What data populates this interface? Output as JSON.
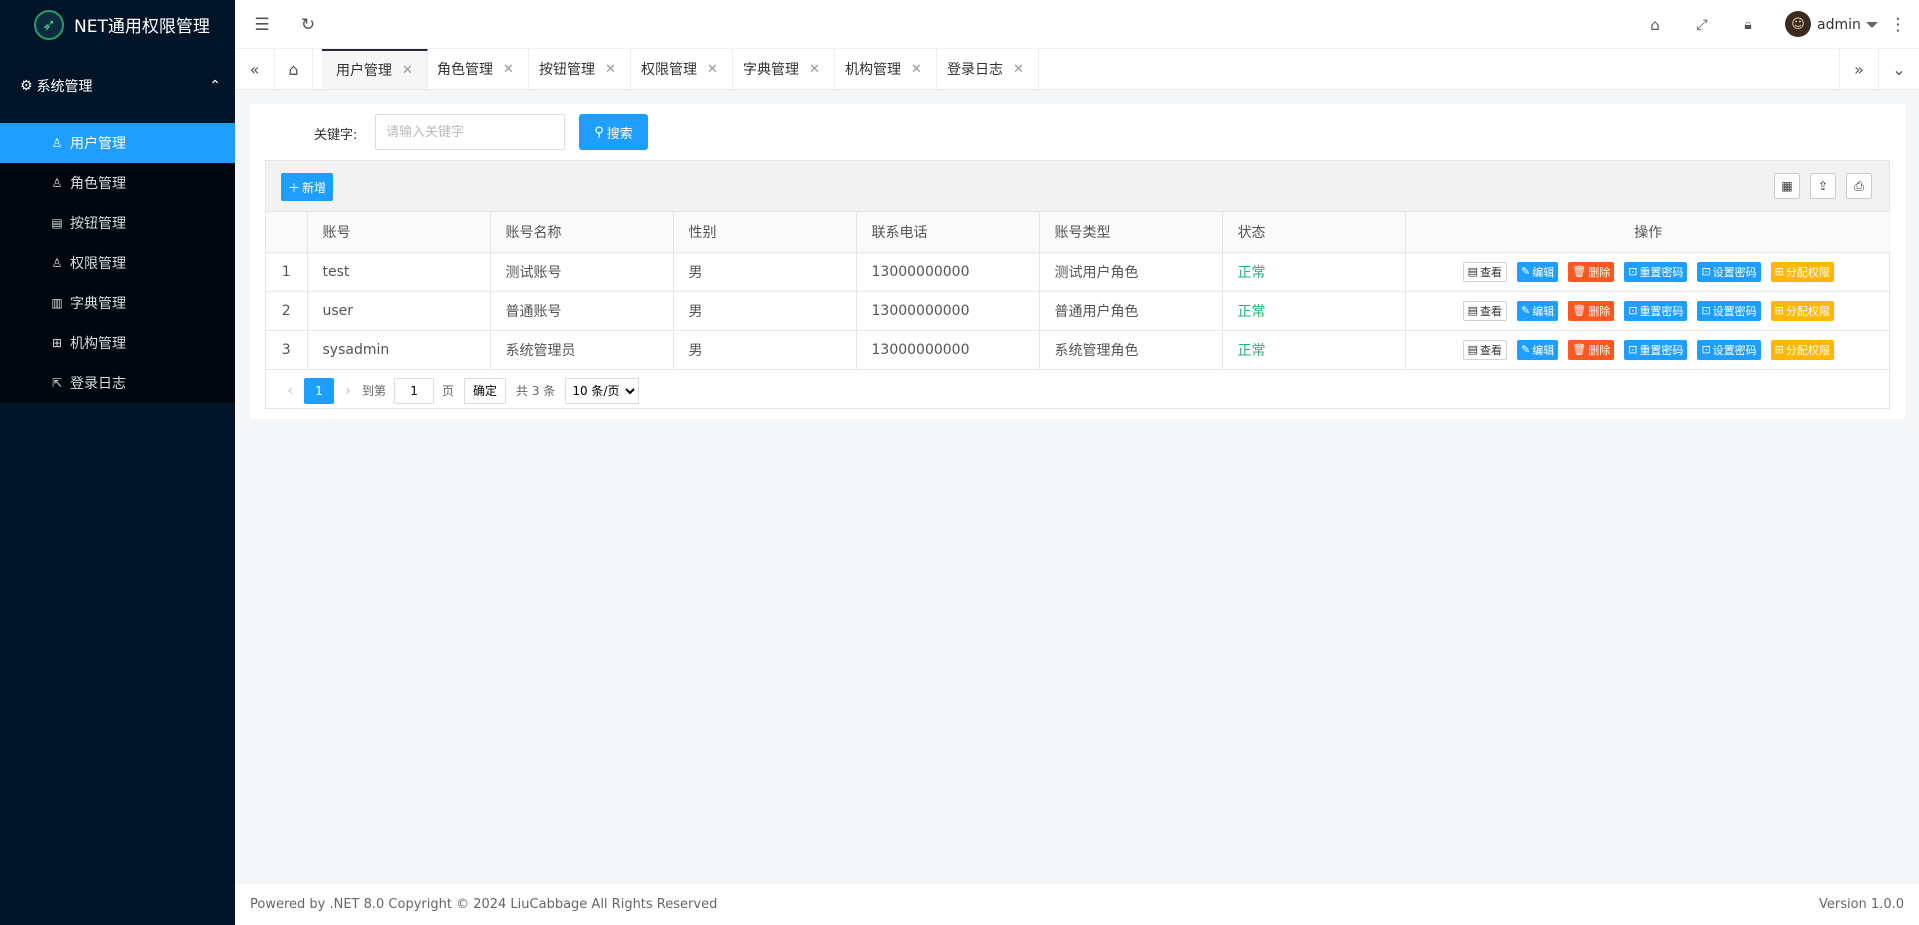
{
  "app": {
    "title": "NET通用权限管理"
  },
  "sidebar": {
    "group_label": "系统管理",
    "items": [
      {
        "label": "用户管理",
        "icon": "user-icon"
      },
      {
        "label": "角色管理",
        "icon": "role-icon"
      },
      {
        "label": "按钮管理",
        "icon": "button-icon"
      },
      {
        "label": "权限管理",
        "icon": "permission-icon"
      },
      {
        "label": "字典管理",
        "icon": "dictionary-icon"
      },
      {
        "label": "机构管理",
        "icon": "organization-icon"
      },
      {
        "label": "登录日志",
        "icon": "login-log-icon"
      }
    ]
  },
  "header": {
    "username": "admin"
  },
  "tabs": [
    {
      "label": "用户管理",
      "active": true
    },
    {
      "label": "角色管理"
    },
    {
      "label": "按钮管理"
    },
    {
      "label": "权限管理"
    },
    {
      "label": "字典管理"
    },
    {
      "label": "机构管理"
    },
    {
      "label": "登录日志"
    }
  ],
  "search": {
    "label": "关键字:",
    "placeholder": "请输入关键字",
    "button": "搜索"
  },
  "toolbar": {
    "add_label": "新增"
  },
  "table": {
    "headers": [
      "",
      "账号",
      "账号名称",
      "性别",
      "联系电话",
      "账号类型",
      "状态",
      "操作"
    ],
    "rows": [
      {
        "index": "1",
        "account": "test",
        "name": "测试账号",
        "gender": "男",
        "phone": "13000000000",
        "type": "测试用户角色",
        "status": "正常"
      },
      {
        "index": "2",
        "account": "user",
        "name": "普通账号",
        "gender": "男",
        "phone": "13000000000",
        "type": "普通用户角色",
        "status": "正常"
      },
      {
        "index": "3",
        "account": "sysadmin",
        "name": "系统管理员",
        "gender": "男",
        "phone": "13000000000",
        "type": "系统管理角色",
        "status": "正常"
      }
    ],
    "actions": {
      "view": "查看",
      "edit": "编辑",
      "delete": "删除",
      "reset": "重置密码",
      "set": "设置密码",
      "perm": "分配权限"
    }
  },
  "pager": {
    "current": "1",
    "goto": "到第",
    "page_input": "1",
    "page_unit": "页",
    "ok": "确定",
    "total": "共 3 条",
    "size": "10 条/页"
  },
  "footer": {
    "left": "Powered by .NET 8.0 Copyright © 2024 LiuCabbage All Rights Reserved",
    "right": "Version 1.0.0"
  },
  "colors": {
    "primary": "#1e9fff",
    "danger": "#ff5722",
    "warn": "#ffb800",
    "success": "#16b777",
    "sidebar": "#021428"
  }
}
